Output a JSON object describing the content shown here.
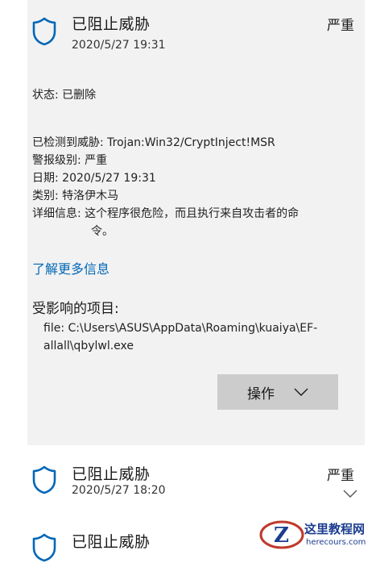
{
  "expanded_item": {
    "title": "已阻止威胁",
    "severity": "严重",
    "date": "2020/5/27 19:31",
    "status_label": "状态:",
    "status_value": "已删除",
    "threat_label": "已检测到威胁:",
    "threat_value": "Trojan:Win32/CryptInject!MSR",
    "alert_label": "警报级别:",
    "alert_value": "严重",
    "date_label": "日期:",
    "date_value": "2020/5/27 19:31",
    "category_label": "类别:",
    "category_value": "特洛伊木马",
    "details_label": "详细信息:",
    "details_line1": "这个程序很危险，而且执行来自攻击者的命",
    "details_line2": "令。",
    "learn_more": "了解更多信息",
    "affected_heading": "受影响的项目:",
    "file_line1": "file: C:\\Users\\ASUS\\AppData\\Roaming\\kuaiya\\EF-",
    "file_line2": "allall\\qbylwl.exe",
    "action_button": "操作",
    "shield_color": "#0067b8"
  },
  "items": [
    {
      "title": "已阻止威胁",
      "severity": "严重",
      "date": "2020/5/27 18:20"
    },
    {
      "title": "已阻止威胁"
    }
  ],
  "watermark": {
    "text": "这里教程网",
    "sub": "herecours.com"
  }
}
